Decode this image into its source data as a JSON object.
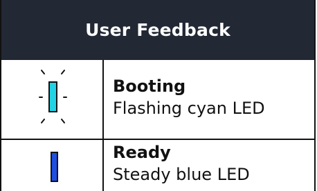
{
  "table": {
    "header": "User Feedback",
    "rows": [
      {
        "title": "Booting",
        "description": "Flashing cyan LED",
        "icon": "flashing-led-icon",
        "led_color": "#22d3e6"
      },
      {
        "title": "Ready",
        "description": "Steady blue LED",
        "icon": "steady-led-icon",
        "led_color": "#1f4fe0"
      }
    ]
  },
  "colors": {
    "header_background": "#222834",
    "border": "#111111"
  }
}
